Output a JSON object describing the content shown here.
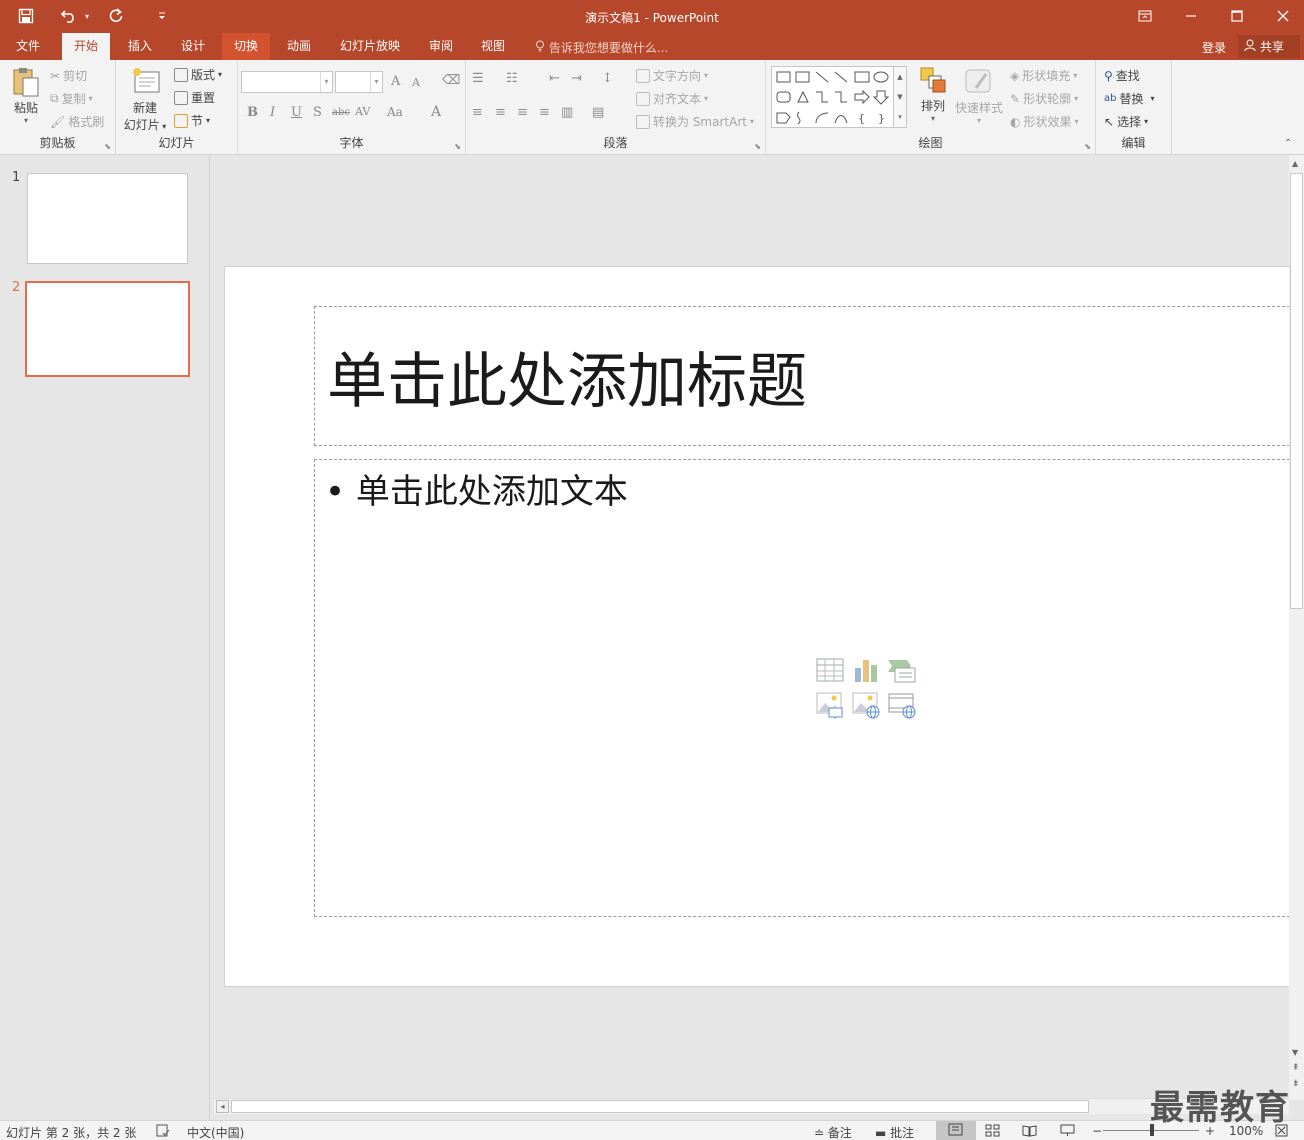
{
  "titlebar": {
    "title": "演示文稿1 - PowerPoint",
    "save_icon": "save-icon",
    "undo_icon": "undo-icon",
    "redo_icon": "redo-icon",
    "customize_icon": "customize-qat-icon"
  },
  "tabs": [
    {
      "label": "文件"
    },
    {
      "label": "开始"
    },
    {
      "label": "插入"
    },
    {
      "label": "设计"
    },
    {
      "label": "切换"
    },
    {
      "label": "动画"
    },
    {
      "label": "幻灯片放映"
    },
    {
      "label": "审阅"
    },
    {
      "label": "视图"
    }
  ],
  "tell_me": "告诉我您想要做什么...",
  "account": {
    "login": "登录",
    "share": "共享"
  },
  "ribbon": {
    "clipboard": {
      "label": "剪贴板",
      "paste": "粘贴",
      "cut": "剪切",
      "copy": "复制",
      "format_painter": "格式刷"
    },
    "slides": {
      "label": "幻灯片",
      "new_slide_1": "新建",
      "new_slide_2": "幻灯片",
      "layout": "版式",
      "reset": "重置",
      "section": "节"
    },
    "font": {
      "label": "字体",
      "bold": "B",
      "italic": "I",
      "underline": "U",
      "shadow": "S",
      "strike": "abc",
      "spacing": "AV",
      "case": "Aa",
      "color": "A",
      "grow": "A",
      "shrink": "A"
    },
    "paragraph": {
      "label": "段落",
      "text_direction": "文字方向",
      "align_text": "对齐文本",
      "convert_smartart": "转换为 SmartArt"
    },
    "drawing": {
      "label": "绘图",
      "arrange": "排列",
      "quick_styles": "快速样式",
      "shape_fill": "形状填充",
      "shape_outline": "形状轮廓",
      "shape_effects": "形状效果"
    },
    "editing": {
      "label": "编辑",
      "find": "查找",
      "replace": "替换",
      "select": "选择"
    }
  },
  "thumbnails": [
    {
      "number": "1"
    },
    {
      "number": "2"
    }
  ],
  "slide": {
    "title_placeholder": "单击此处添加标题",
    "body_bullet": "•",
    "body_placeholder": "单击此处添加文本"
  },
  "statusbar": {
    "slide_info": "幻灯片 第 2 张，共 2 张",
    "language": "中文(中国)",
    "notes": "备注",
    "comments": "批注",
    "zoom": "100%"
  },
  "watermark": "最需教育",
  "colors": {
    "brand": "#b7472a",
    "selected_thumb": "#e16d4c"
  }
}
